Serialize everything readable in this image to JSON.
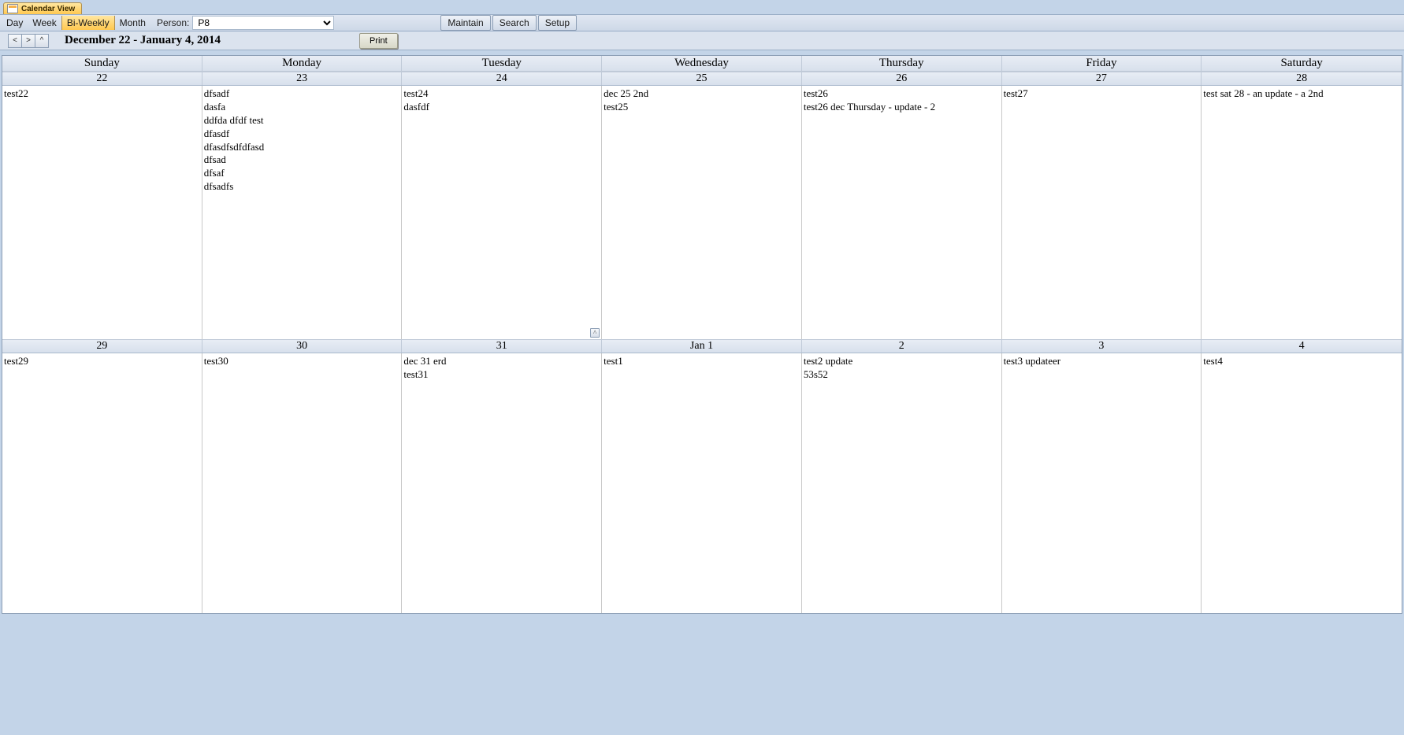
{
  "tab": {
    "title": "Calendar View"
  },
  "toolbar": {
    "views": {
      "day": "Day",
      "week": "Week",
      "biweekly": "Bi-Weekly",
      "month": "Month"
    },
    "person_label": "Person:",
    "person_value": "P8",
    "maintain": "Maintain",
    "search": "Search",
    "setup": "Setup"
  },
  "nav": {
    "prev": "<",
    "next": ">",
    "up": "^",
    "date_range": "December 22 - January 4, 2014",
    "print": "Print"
  },
  "day_names": [
    "Sunday",
    "Monday",
    "Tuesday",
    "Wednesday",
    "Thursday",
    "Friday",
    "Saturday"
  ],
  "weeks": [
    {
      "dates": [
        "22",
        "23",
        "24",
        "25",
        "26",
        "27",
        "28"
      ],
      "events": [
        [
          "test22"
        ],
        [
          "dfsadf",
          "dasfa",
          "ddfda dfdf test",
          "dfasdf",
          "dfasdfsdfdfasd",
          "dfsad",
          "dfsaf",
          "dfsadfs"
        ],
        [
          "test24",
          "dasfdf"
        ],
        [
          "dec 25 2nd",
          "test25"
        ],
        [
          "test26",
          "test26 dec Thursday - update - 2"
        ],
        [
          "test27"
        ],
        [
          "test sat 28 - an update - a 2nd"
        ]
      ],
      "marker_col": 2,
      "marker_label": "^"
    },
    {
      "dates": [
        "29",
        "30",
        "31",
        "Jan 1",
        "2",
        "3",
        "4"
      ],
      "events": [
        [
          "test29"
        ],
        [
          "test30"
        ],
        [
          "dec 31 erd",
          "test31"
        ],
        [
          "test1"
        ],
        [
          "test2 update",
          "53s52"
        ],
        [
          "test3 updateer"
        ],
        [
          "test4"
        ]
      ]
    }
  ]
}
